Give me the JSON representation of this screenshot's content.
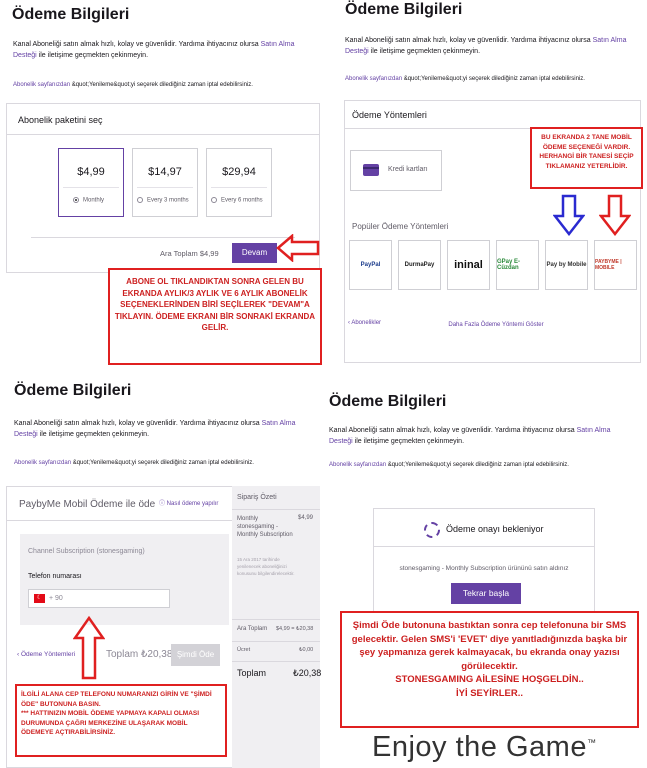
{
  "heading": "Ödeme Bilgileri",
  "intro_text": "Kanal Aboneliği satın almak hızlı, kolay ve güvenlidir. Yardıma ihtiyacınız olursa",
  "intro_link": "Satın Alma Desteği",
  "intro_tail": "ile iletişime geçmekten çekinmeyin.",
  "sub_link": "Abonelik sayfanızdan",
  "sub_text": "&quot;Yenileme&quot;yi seçerek dilediğiniz zaman iptal edebilirsiniz.",
  "panel1": {
    "card_title": "Abonelik paketini seç",
    "options": [
      {
        "price": "$4,99",
        "label": "Monthly"
      },
      {
        "price": "$14,97",
        "label": "Every 3 months"
      },
      {
        "price": "$29,94",
        "label": "Every 6 months"
      }
    ],
    "subtotal": "Ara Toplam $4,99",
    "continue_button": "Devam",
    "note": "ABONE OL TIKLANDIKTAN SONRA GELEN BU EKRANDA AYLIK/3 AYLIK VE 6 AYLIK ABONELİK SEÇENEKLERİNDEN BİRİ SEÇİLEREK \"DEVAM\"A TIKLAYIN. ÖDEME EKRANI BİR SONRAKİ EKRANDA GELİR."
  },
  "panel2": {
    "card_title": "Ödeme Yöntemleri",
    "credit_card_label": "Kredi kartları",
    "popular_title": "Popüler Ödeme Yöntemleri",
    "methods": [
      "PayPal",
      "DurmaPay",
      "ininal",
      "GPay E-Cüzdan",
      "Pay by Mobile",
      "PAYBYME | MOBILE"
    ],
    "back_link": "Abonelikler",
    "more_link": "Daha Fazla Ödeme Yöntemi Göster",
    "note": "BU EKRANDA 2 TANE MOBİL ÖDEME SEÇENEĞİ VARDIR. HERHANGİ BİR TANESİ SEÇİP TIKLAMANIZ YETERLİDİR."
  },
  "panel3": {
    "card_title": "PaybyMe Mobil Ödeme ile öde",
    "how_to_link": "Nasıl ödeme yapılır",
    "channel": "Channel Subscription (stonesgaming)",
    "phone_label": "Telefon numarası",
    "phone_prefix": "+ 90",
    "back_link": "Ödeme Yöntemleri",
    "total_inline": "Toplam ₺20,38",
    "pay_button": "Şimdi Öde",
    "summary_title": "Sipariş Özeti",
    "summary_item": "Monthly stonesgaming - Monthly Subscription",
    "summary_price": "$4,99",
    "summary_fineprint": "15 Ara 2017 tarihinde yenilenecek aboneliğinizi konusunu bilgilendirelecektir.",
    "subtotal_label": "Ara Toplam",
    "subtotal_value": "$4,99 = ₺20,38",
    "fee_label": "Ücret",
    "fee_value": "₺0,00",
    "total_label": "Toplam",
    "total_value": "₺20,38",
    "note": "İLGİLİ ALANA CEP TELEFONU NUMARANIZI GİRİN VE \"ŞİMDİ ÖDE\" BUTONUNA BASIN.\n*** HATTINIZIN MOBİL ÖDEME YAPMAYA KAPALI OLMASI DURUMUNDA ÇAĞRI MERKEZİNE ULAŞARAK MOBİL ÖDEMEYE AÇTIRABİLİRSİNİZ."
  },
  "panel4": {
    "waiting_title": "Ödeme onayı bekleniyor",
    "waiting_text": "stonesgaming - Monthly Subscription ürününü satın aldınız",
    "retry_button": "Tekrar başla",
    "note": "Şimdi Öde butonuna bastıktan sonra cep telefonuna bir SMS gelecektir. Gelen SMS'i 'EVET' diye yanıtladığınızda başka bir şey yapmanıza gerek kalmayacak, bu ekranda onay yazısı görülecektir.\nSTONESGAMING AİLESİNE HOŞGELDİN..\nİYİ SEYİRLER..",
    "brand": "Enjoy the Game",
    "brand_mark": "™"
  },
  "colors": {
    "accent": "#6441a4",
    "annotation_red": "#e02020",
    "annotation_blue": "#2a2ad0"
  }
}
